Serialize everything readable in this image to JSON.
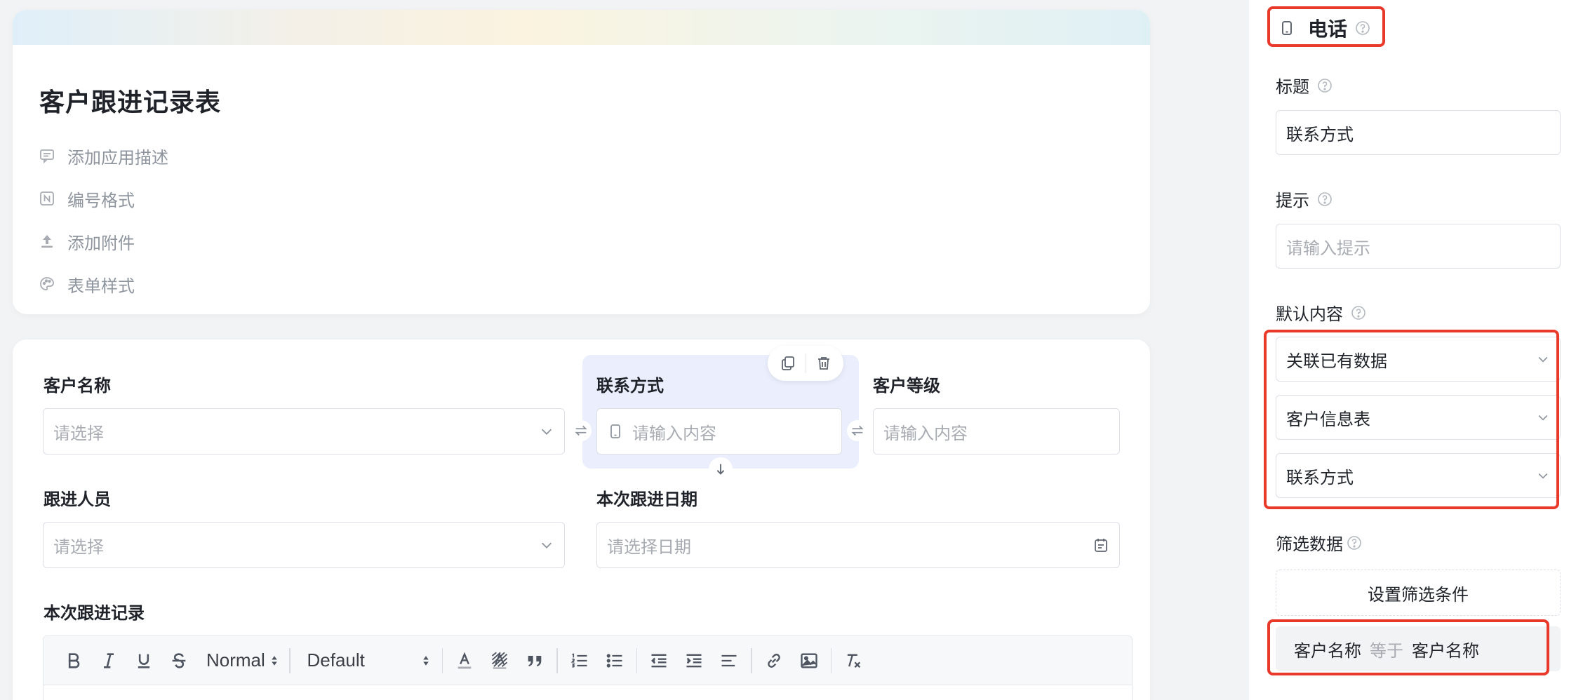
{
  "form": {
    "title": "客户跟进记录表",
    "meta": [
      {
        "label": "添加应用描述",
        "icon": "comment-icon"
      },
      {
        "label": "编号格式",
        "icon": "numbering-icon"
      },
      {
        "label": "添加附件",
        "icon": "upload-icon"
      },
      {
        "label": "表单样式",
        "icon": "palette-icon"
      }
    ]
  },
  "fields": {
    "customer_name": {
      "label": "客户名称",
      "placeholder": "请选择"
    },
    "contact": {
      "label": "联系方式",
      "placeholder": "请输入内容"
    },
    "customer_level": {
      "label": "客户等级",
      "placeholder": "请输入内容"
    },
    "follower": {
      "label": "跟进人员",
      "placeholder": "请选择"
    },
    "follow_date": {
      "label": "本次跟进日期",
      "placeholder": "请选择日期"
    },
    "follow_record": {
      "label": "本次跟进记录"
    }
  },
  "editor": {
    "heading_select": "Normal",
    "font_select": "Default"
  },
  "panel": {
    "component_title": "电话",
    "title_label": "标题",
    "title_value": "联系方式",
    "hint_label": "提示",
    "hint_placeholder": "请输入提示",
    "default_label": "默认内容",
    "default_mode": "关联已有数据",
    "default_table": "客户信息表",
    "default_field": "联系方式",
    "filter_label": "筛选数据",
    "filter_button": "设置筛选条件",
    "condition": {
      "left": "客户名称",
      "op": "等于",
      "right": "客户名称"
    }
  },
  "colors": {
    "highlight": "#e8392b",
    "selected_bg": "#ebeffd",
    "placeholder": "#a8abb2"
  }
}
